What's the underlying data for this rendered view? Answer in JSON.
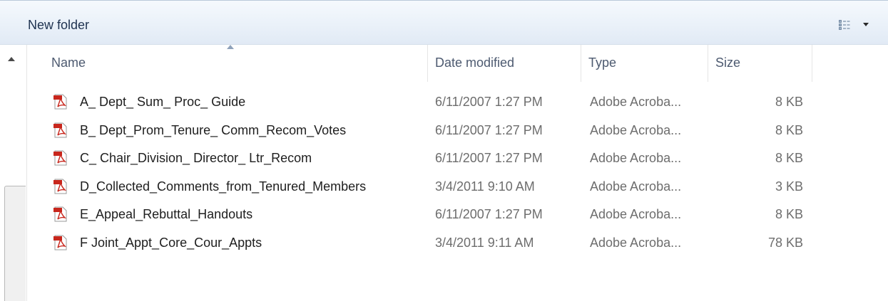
{
  "toolbar": {
    "new_folder_label": "New folder"
  },
  "columns": {
    "name": "Name",
    "date": "Date modified",
    "type": "Type",
    "size": "Size"
  },
  "files": [
    {
      "name": "A_ Dept_ Sum_ Proc_ Guide",
      "date": "6/11/2007 1:27 PM",
      "type": "Adobe Acroba...",
      "size": "8 KB",
      "icon": "pdf-icon"
    },
    {
      "name": "B_ Dept_Prom_Tenure_ Comm_Recom_Votes",
      "date": "6/11/2007 1:27 PM",
      "type": "Adobe Acroba...",
      "size": "8 KB",
      "icon": "pdf-icon"
    },
    {
      "name": "C_ Chair_Division_ Director_ Ltr_Recom",
      "date": "6/11/2007 1:27 PM",
      "type": "Adobe Acroba...",
      "size": "8 KB",
      "icon": "pdf-icon"
    },
    {
      "name": "D_Collected_Comments_from_Tenured_Members",
      "date": "3/4/2011 9:10 AM",
      "type": "Adobe Acroba...",
      "size": "3 KB",
      "icon": "pdf-icon"
    },
    {
      "name": "E_Appeal_Rebuttal_Handouts",
      "date": "6/11/2007 1:27 PM",
      "type": "Adobe Acroba...",
      "size": "8 KB",
      "icon": "pdf-icon"
    },
    {
      "name": "F Joint_Appt_Core_Cour_Appts",
      "date": "3/4/2011 9:11 AM",
      "type": "Adobe Acroba...",
      "size": "78 KB",
      "icon": "pdf-icon"
    }
  ],
  "colors": {
    "toolbar_text": "#1e3250",
    "header_text": "#4d5a70",
    "secondary_text": "#6d6d6d",
    "pdf_red": "#c8261c"
  }
}
